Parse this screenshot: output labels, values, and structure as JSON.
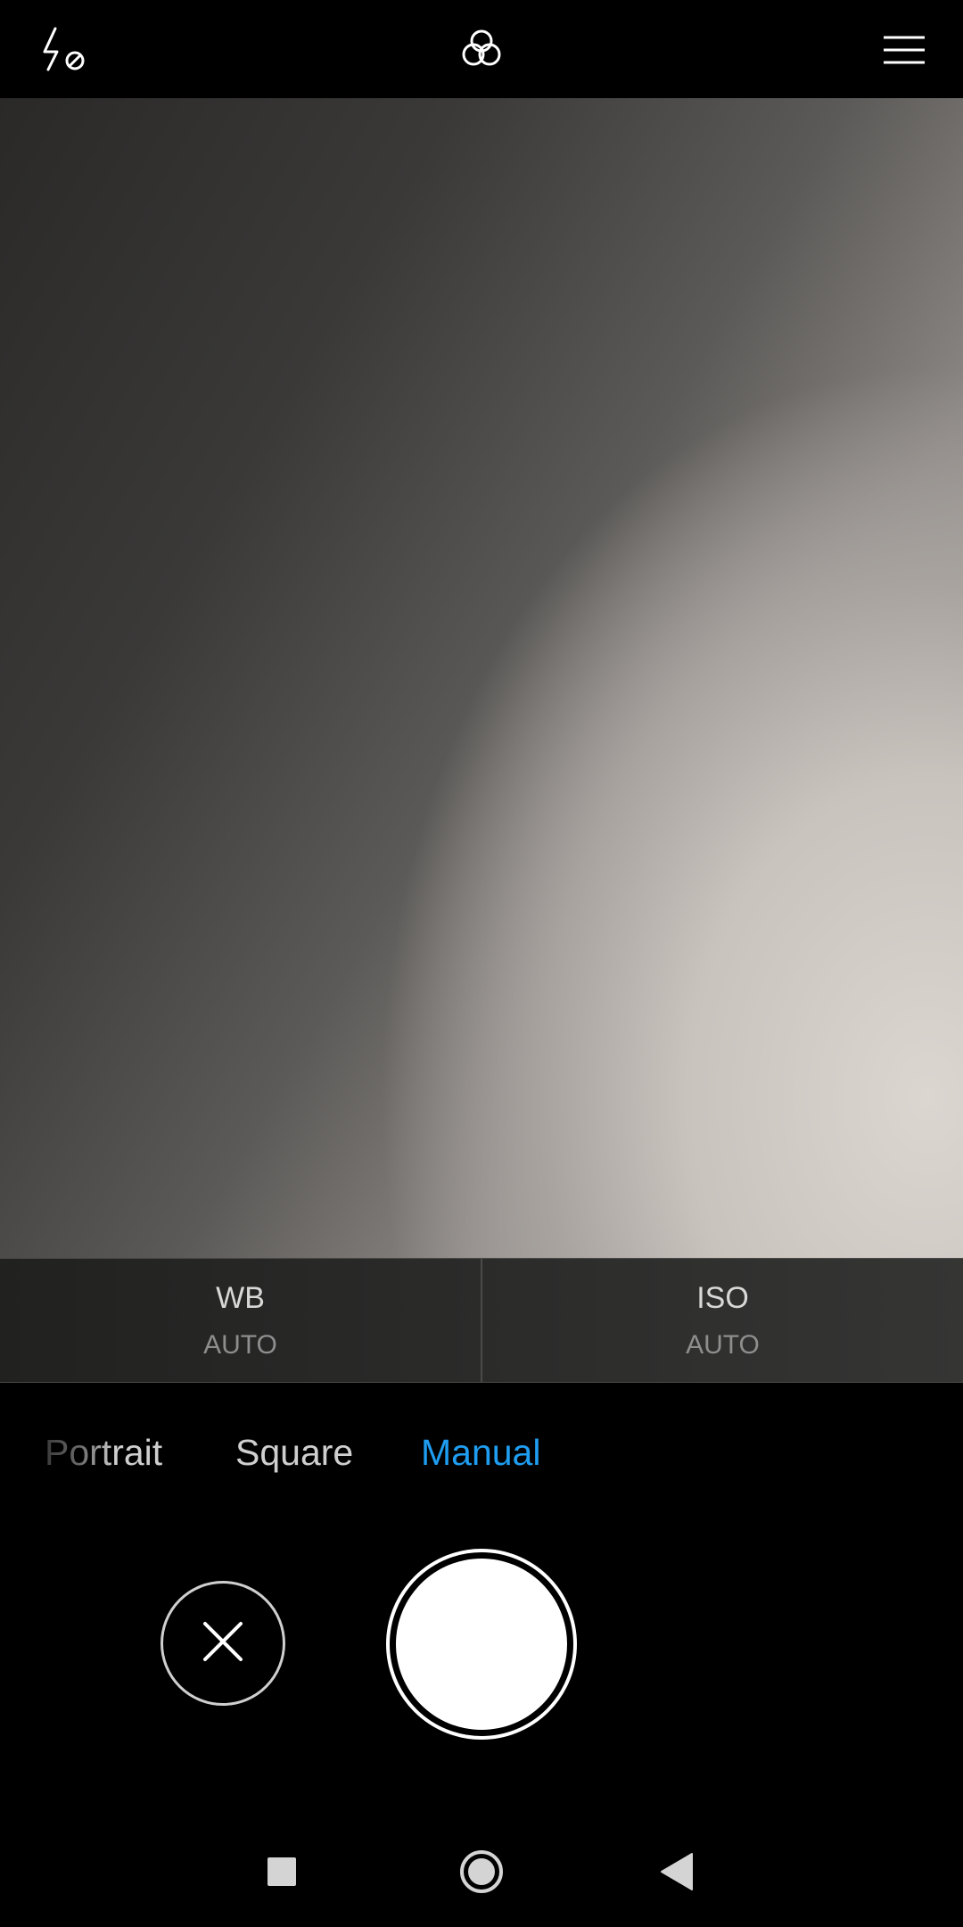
{
  "topbar": {
    "flash_icon": "flash-off-icon",
    "filter_icon": "filters-icon",
    "menu_icon": "menu-icon"
  },
  "settings": {
    "wb": {
      "label": "WB",
      "value": "AUTO"
    },
    "iso": {
      "label": "ISO",
      "value": "AUTO"
    }
  },
  "modes": {
    "items": [
      "Portrait",
      "Square",
      "Manual"
    ],
    "selected": "Manual",
    "selected_color": "#1f9df0"
  },
  "controls": {
    "cancel_icon": "close-icon",
    "shutter_icon": "shutter-icon"
  },
  "navbar": {
    "recents_icon": "recents-square-icon",
    "home_icon": "home-circle-icon",
    "back_icon": "back-triangle-icon"
  }
}
